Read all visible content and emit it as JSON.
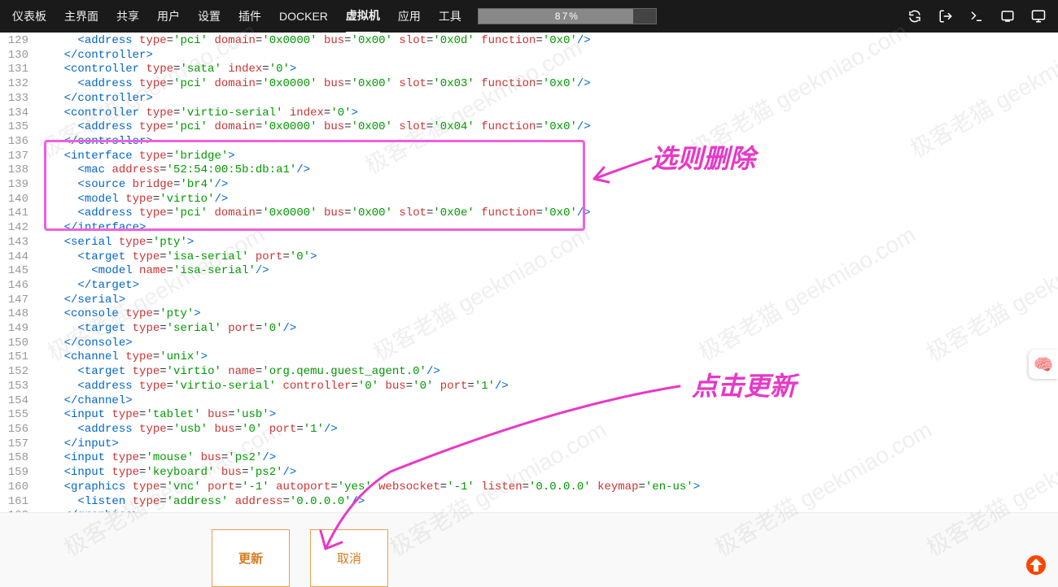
{
  "nav": {
    "items": [
      "仪表板",
      "主界面",
      "共享",
      "用户",
      "设置",
      "插件",
      "DOCKER",
      "虚拟机",
      "应用",
      "工具"
    ],
    "active_index": 7
  },
  "progress": {
    "percent": 87,
    "text": "87%"
  },
  "buttons": {
    "update": "更新",
    "cancel": "取消"
  },
  "annotations": {
    "top": "选则删除",
    "bottom": "点击更新"
  },
  "watermark_text": "极客老猫 geekmiao.com",
  "code_lines": [
    {
      "n": 129,
      "indent": 3,
      "raw": "  <address type='pci' domain='0x0000' bus='0x00' slot='0x0d' function='0x0'/>"
    },
    {
      "n": 130,
      "indent": 2,
      "raw": "</controller>"
    },
    {
      "n": 131,
      "indent": 2,
      "raw": "<controller type='sata' index='0'>"
    },
    {
      "n": 132,
      "indent": 3,
      "raw": "  <address type='pci' domain='0x0000' bus='0x00' slot='0x03' function='0x0'/>"
    },
    {
      "n": 133,
      "indent": 2,
      "raw": "</controller>"
    },
    {
      "n": 134,
      "indent": 2,
      "raw": "<controller type='virtio-serial' index='0'>"
    },
    {
      "n": 135,
      "indent": 3,
      "raw": "  <address type='pci' domain='0x0000' bus='0x00' slot='0x04' function='0x0'/>"
    },
    {
      "n": 136,
      "indent": 2,
      "raw": "</controller>"
    },
    {
      "n": 137,
      "indent": 2,
      "raw": "<interface type='bridge'>"
    },
    {
      "n": 138,
      "indent": 3,
      "raw": "  <mac address='52:54:00:5b:db:a1'/>"
    },
    {
      "n": 139,
      "indent": 3,
      "raw": "  <source bridge='br4'/>"
    },
    {
      "n": 140,
      "indent": 3,
      "raw": "  <model type='virtio'/>"
    },
    {
      "n": 141,
      "indent": 3,
      "raw": "  <address type='pci' domain='0x0000' bus='0x00' slot='0x0e' function='0x0'/>"
    },
    {
      "n": 142,
      "indent": 2,
      "raw": "</interface>"
    },
    {
      "n": 143,
      "indent": 2,
      "raw": "<serial type='pty'>"
    },
    {
      "n": 144,
      "indent": 3,
      "raw": "  <target type='isa-serial' port='0'>"
    },
    {
      "n": 145,
      "indent": 4,
      "raw": "    <model name='isa-serial'/>"
    },
    {
      "n": 146,
      "indent": 3,
      "raw": "  </target>"
    },
    {
      "n": 147,
      "indent": 2,
      "raw": "</serial>"
    },
    {
      "n": 148,
      "indent": 2,
      "raw": "<console type='pty'>"
    },
    {
      "n": 149,
      "indent": 3,
      "raw": "  <target type='serial' port='0'/>"
    },
    {
      "n": 150,
      "indent": 2,
      "raw": "</console>"
    },
    {
      "n": 151,
      "indent": 2,
      "raw": "<channel type='unix'>"
    },
    {
      "n": 152,
      "indent": 3,
      "raw": "  <target type='virtio' name='org.qemu.guest_agent.0'/>"
    },
    {
      "n": 153,
      "indent": 3,
      "raw": "  <address type='virtio-serial' controller='0' bus='0' port='1'/>"
    },
    {
      "n": 154,
      "indent": 2,
      "raw": "</channel>"
    },
    {
      "n": 155,
      "indent": 2,
      "raw": "<input type='tablet' bus='usb'>"
    },
    {
      "n": 156,
      "indent": 3,
      "raw": "  <address type='usb' bus='0' port='1'/>"
    },
    {
      "n": 157,
      "indent": 2,
      "raw": "</input>"
    },
    {
      "n": 158,
      "indent": 2,
      "raw": "<input type='mouse' bus='ps2'/>"
    },
    {
      "n": 159,
      "indent": 2,
      "raw": "<input type='keyboard' bus='ps2'/>"
    },
    {
      "n": 160,
      "indent": 2,
      "raw": "<graphics type='vnc' port='-1' autoport='yes' websocket='-1' listen='0.0.0.0' keymap='en-us'>"
    },
    {
      "n": 161,
      "indent": 3,
      "raw": "  <listen type='address' address='0.0.0.0'/>"
    },
    {
      "n": 162,
      "indent": 2,
      "raw": "</graphics>"
    }
  ]
}
